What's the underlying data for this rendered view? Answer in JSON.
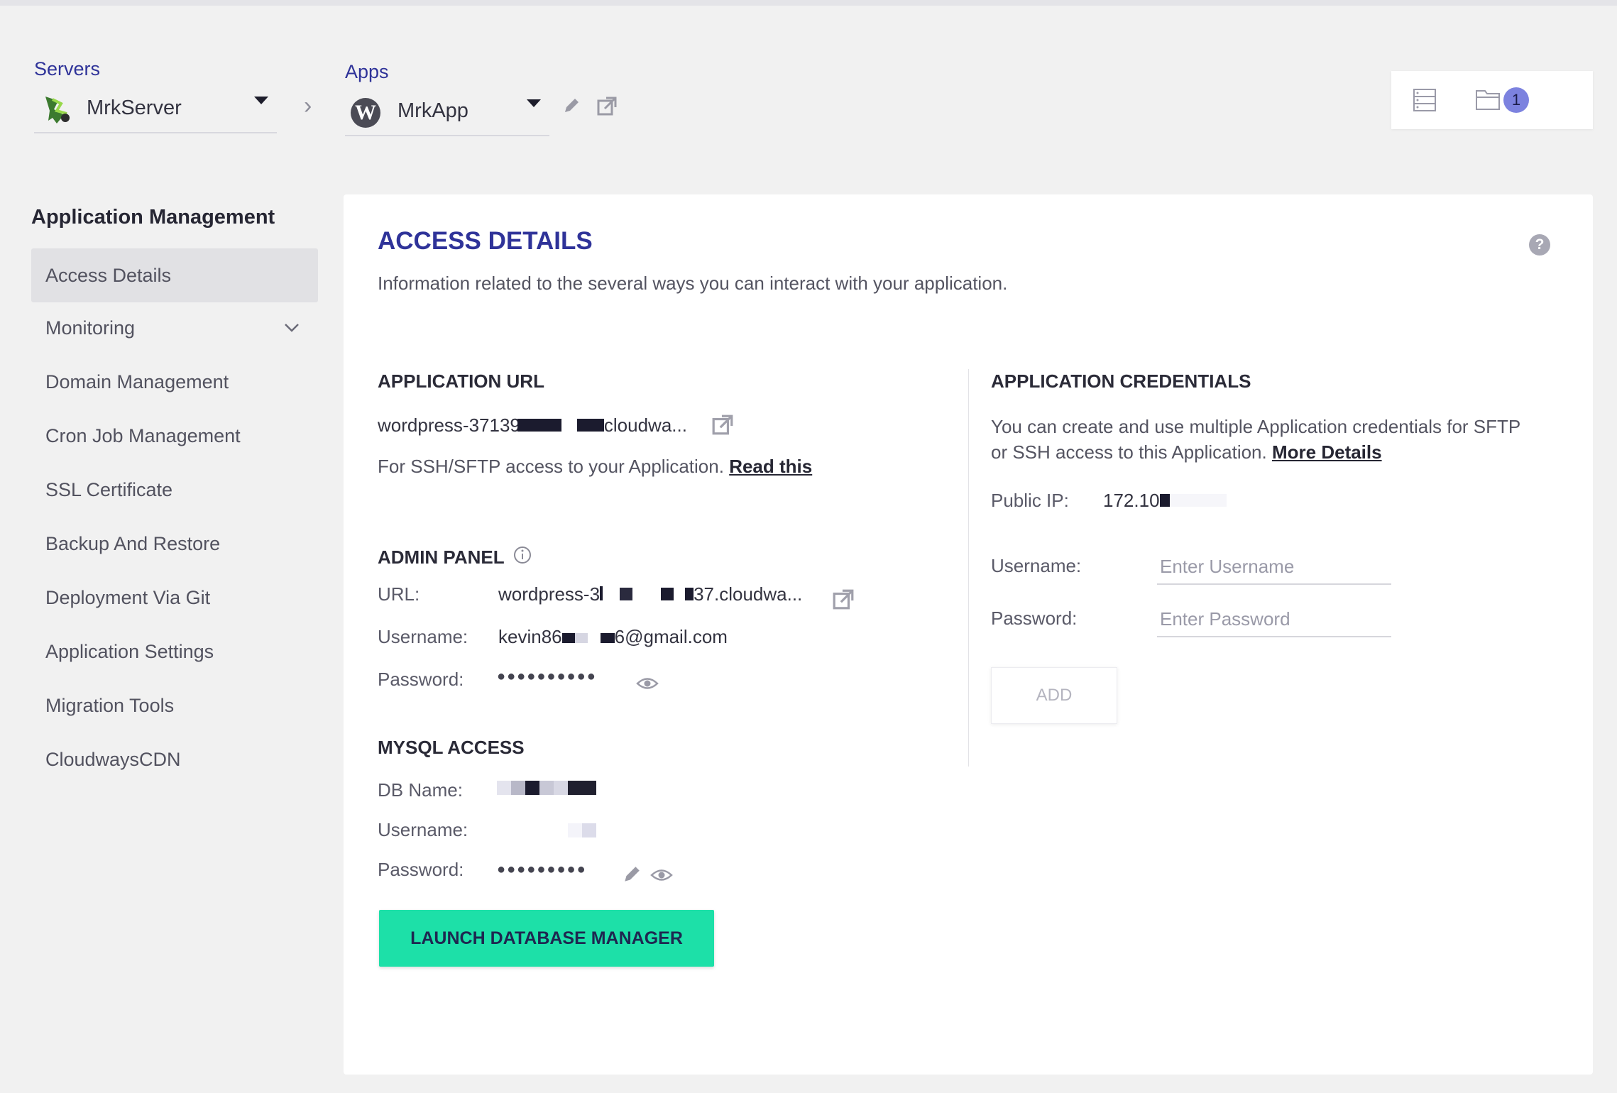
{
  "header": {
    "servers_label": "Servers",
    "server_name": "MrkServer",
    "apps_label": "Apps",
    "app_name": "MrkApp",
    "notification_count": "1"
  },
  "sidebar": {
    "title": "Application Management",
    "items": [
      {
        "label": "Access Details"
      },
      {
        "label": "Monitoring"
      },
      {
        "label": "Domain Management"
      },
      {
        "label": "Cron Job Management"
      },
      {
        "label": "SSL Certificate"
      },
      {
        "label": "Backup And Restore"
      },
      {
        "label": "Deployment Via Git"
      },
      {
        "label": "Application Settings"
      },
      {
        "label": "Migration Tools"
      },
      {
        "label": "CloudwaysCDN"
      }
    ]
  },
  "main": {
    "title": "ACCESS DETAILS",
    "subtitle": "Information related to the several ways you can interact with your application.",
    "app_url": {
      "heading": "APPLICATION URL",
      "url_start": "wordpress-37139",
      "url_end": "cloudwa...",
      "ssh_note": "For SSH/SFTP access to your Application.",
      "read_this": "Read this"
    },
    "admin_panel": {
      "heading": "ADMIN PANEL",
      "url_label": "URL:",
      "url_start": "wordpress-3",
      "url_end": "37.cloudwa...",
      "username_label": "Username:",
      "username_start": "kevin86",
      "username_end": "6@gmail.com",
      "password_label": "Password:",
      "password_mask": "●●●●●●●●●●"
    },
    "mysql": {
      "heading": "MYSQL ACCESS",
      "db_name_label": "DB Name:",
      "username_label": "Username:",
      "password_label": "Password:",
      "password_mask": "●●●●●●●●●",
      "launch_button": "LAUNCH DATABASE MANAGER"
    },
    "credentials": {
      "heading": "APPLICATION CREDENTIALS",
      "desc_line1": "You can create and use multiple Application credentials for SFTP",
      "desc_line2": "or SSH access to this Application.",
      "more_details": "More Details",
      "public_ip_label": "Public IP:",
      "public_ip_value": "172.10",
      "username_label": "Username:",
      "username_placeholder": "Enter Username",
      "password_label": "Password:",
      "password_placeholder": "Enter Password",
      "add_button": "ADD"
    }
  },
  "colors": {
    "accent": "#2f3399",
    "launch_button": "#1de0a8",
    "badge": "#7c82df"
  }
}
